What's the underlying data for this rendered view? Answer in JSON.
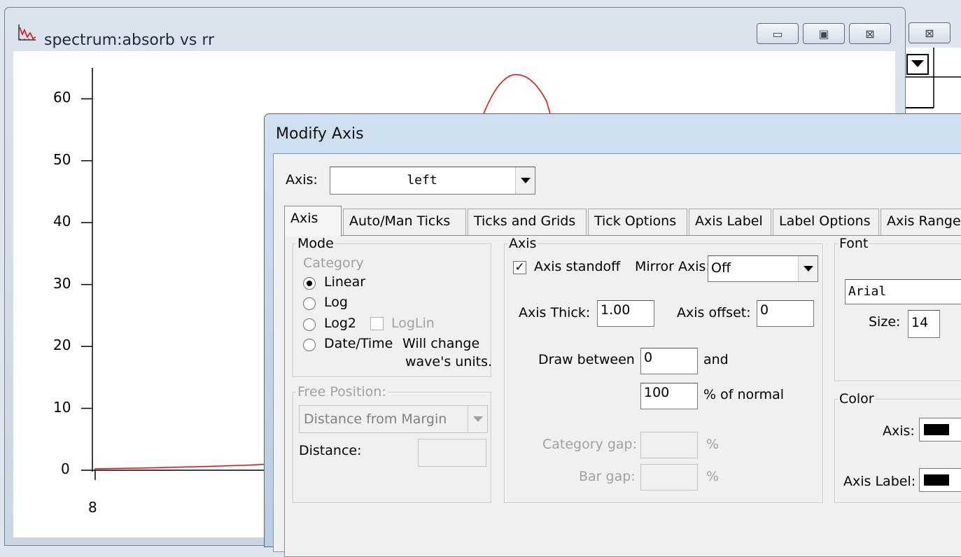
{
  "graph_window": {
    "title": "spectrum:absorb vs rr",
    "icon": "graph-icon",
    "buttons": {
      "minimize": "▭",
      "restore": "▣",
      "close": "⊠"
    }
  },
  "chart_data": {
    "type": "line",
    "ylim": [
      0,
      65
    ],
    "y_ticks": [
      "60",
      "50",
      "40",
      "30",
      "20",
      "10",
      "0"
    ],
    "x_ticks": [
      "8"
    ],
    "series": [
      {
        "color": "#ff0000"
      }
    ]
  },
  "right_strip": {
    "close": "⊠"
  },
  "dialog": {
    "title": "Modify Axis",
    "axis_label": "Axis:",
    "axis_value": "left",
    "tabs": [
      "Axis",
      "Auto/Man Ticks",
      "Ticks and Grids",
      "Tick Options",
      "Axis Label",
      "Label Options",
      "Axis Range"
    ],
    "mode": {
      "legend": "Mode",
      "category": "Category",
      "options": [
        "Linear",
        "Log",
        "Log2",
        "Date/Time"
      ],
      "selected": "Linear",
      "loglin": "LogLin",
      "date_note_1": "Will change",
      "date_note_2": "wave's units."
    },
    "free_position": {
      "legend": "Free Position:",
      "select": "Distance from Margin",
      "distance_label": "Distance:",
      "distance_value": ""
    },
    "axis_group": {
      "legend": "Axis",
      "standoff_label": "Axis standoff",
      "standoff_checked": true,
      "mirror_label": "Mirror Axis:",
      "mirror_value": "Off",
      "thick_label": "Axis Thick:",
      "thick_value": "1.00",
      "offset_label": "Axis offset:",
      "offset_value": "0",
      "draw_between_label": "Draw between",
      "draw_from": "0",
      "and_label": "and",
      "draw_to": "100",
      "of_normal": "% of normal",
      "category_gap_label": "Category gap:",
      "bar_gap_label": "Bar gap:",
      "percent": "%"
    },
    "font_group": {
      "legend": "Font",
      "font_value": "Arial",
      "size_label": "Size:",
      "size_value": "14"
    },
    "color_group": {
      "legend": "Color",
      "axis_label": "Axis:",
      "axis_label_label": "Axis Label:",
      "axis_color": "#000000",
      "axis_label_color": "#000000"
    }
  }
}
